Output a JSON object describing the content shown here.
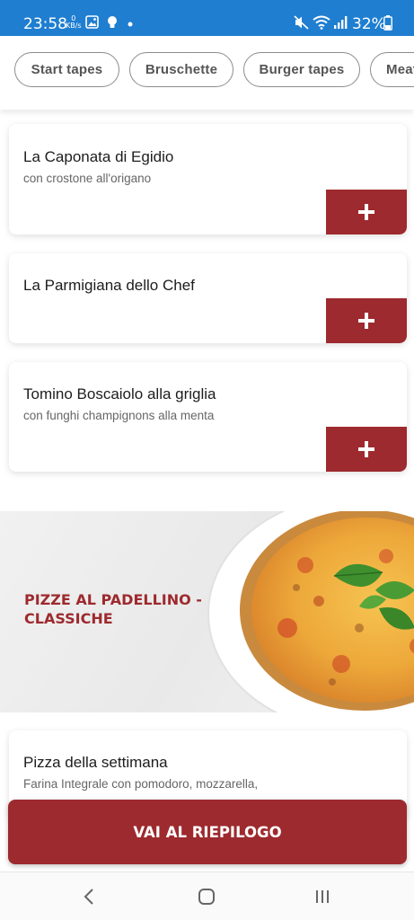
{
  "status": {
    "time": "23:58",
    "speed_value": "0",
    "speed_unit": "KB/s",
    "battery": "32%"
  },
  "chips": [
    "Start tapes",
    "Bruschette",
    "Burger tapes",
    "Meat"
  ],
  "products": [
    {
      "name": "La Caponata di Egidio",
      "desc": "con crostone all'origano"
    },
    {
      "name": "La Parmigiana dello Chef",
      "desc": ""
    },
    {
      "name": "Tomino Boscaiolo alla griglia",
      "desc": "con funghi champignons alla menta"
    },
    {
      "name": "Pizza della settimana",
      "desc": "Farina Integrale con pomodoro, mozzarella,"
    }
  ],
  "add_symbol": "+",
  "section": {
    "title": "PIZZE AL PADELLINO - CLASSICHE"
  },
  "checkout": {
    "label": "VAI AL RIEPILOGO"
  },
  "colors": {
    "accent": "#9d2a2e",
    "status_bar": "#1f7ed0"
  },
  "icons": {
    "status": [
      "image-icon",
      "lightbulb-icon",
      "dot-icon",
      "mute-icon",
      "wifi-icon",
      "signal-icon",
      "battery-icon"
    ],
    "nav": [
      "back-icon",
      "home-icon",
      "recent-apps-icon"
    ]
  }
}
